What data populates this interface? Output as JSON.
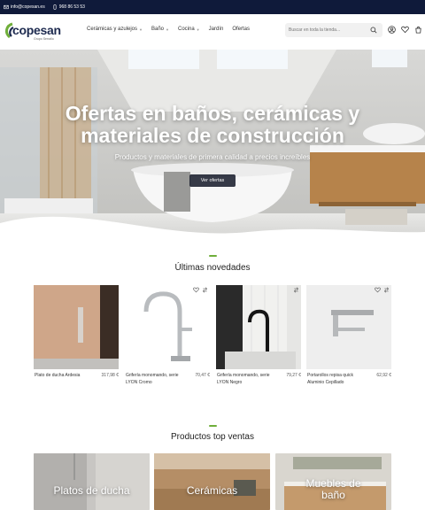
{
  "topbar": {
    "email": "info@copesan.es",
    "phone": "968 86 53 53"
  },
  "header": {
    "logo_text": "copesan",
    "logo_sub": "Grupo Serrallo",
    "nav": [
      {
        "label": "Cerámicas y azulejos",
        "has_dropdown": true
      },
      {
        "label": "Baño",
        "has_dropdown": true
      },
      {
        "label": "Cocina",
        "has_dropdown": true
      },
      {
        "label": "Jardín",
        "has_dropdown": false
      },
      {
        "label": "Ofertas",
        "has_dropdown": false
      }
    ],
    "search_placeholder": "Buscar en toda la tienda...",
    "icons": [
      "user-icon",
      "heart-icon",
      "cart-icon"
    ]
  },
  "hero": {
    "title": "Ofertas en baños, cerámicas y materiales de construcción",
    "subtitle": "Productos y materiales de primera calidad a precios increíbles",
    "button": "Ver ofertas"
  },
  "latest": {
    "title": "Últimas novedades",
    "products": [
      {
        "name": "Plato de ducha Ardesia",
        "price": "317,98 €"
      },
      {
        "name": "Grifería monomando, serie LYON Cromo",
        "price": "70,47 €"
      },
      {
        "name": "Grifería monomando, serie LYON Negro",
        "price": "79,27 €"
      },
      {
        "name": "Portarollos repisa quick Aluminio Cepillado",
        "price": "62,92 €"
      }
    ]
  },
  "top_sales": {
    "title": "Productos top ventas",
    "categories": [
      {
        "label": "Platos de ducha"
      },
      {
        "label": "Cerámicas"
      },
      {
        "label": "Muebles de baño"
      }
    ]
  },
  "colors": {
    "topbar_bg": "#0f1a3a",
    "accent_green": "#6fae3a",
    "brand_navy": "#1d2a4f"
  }
}
